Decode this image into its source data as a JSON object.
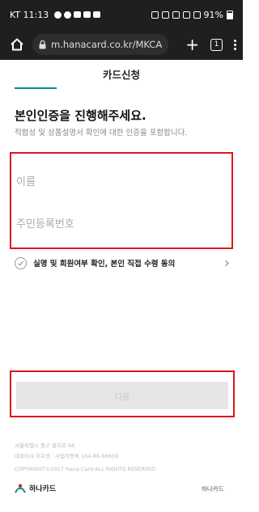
{
  "status_bar": {
    "carrier_time": "KT 11:13",
    "battery": "91%"
  },
  "browser": {
    "url": "m.hanacard.co.kr/MKCA",
    "tab_count": "1"
  },
  "header": {
    "title": "카드신청",
    "progress": 0.25
  },
  "form": {
    "heading": "본인인증을 진행해주세요.",
    "subheading": "적합성 및 상품설명서 확인에 대한 인증을 포함합니다.",
    "name_placeholder": "이름",
    "ssn_placeholder": "주민등록번호",
    "agree_label": "실명 및 회원여부 확인, 본인 직접 수령 동의",
    "next_label": "다음"
  },
  "footer": {
    "address": "서울특별시 중구 을지로 66",
    "business": "대표이사 이호성 · 사업자등록 104-86-56659",
    "copyright": "COPYRIGHT©2017 Hana Card ALL RIGHTS RESERVED",
    "logo_text": "하나카드",
    "right_link": "하나카드"
  },
  "colors": {
    "accent": "#00908a",
    "highlight_border": "#e0141e",
    "button_disabled": "#e6e6e6"
  }
}
